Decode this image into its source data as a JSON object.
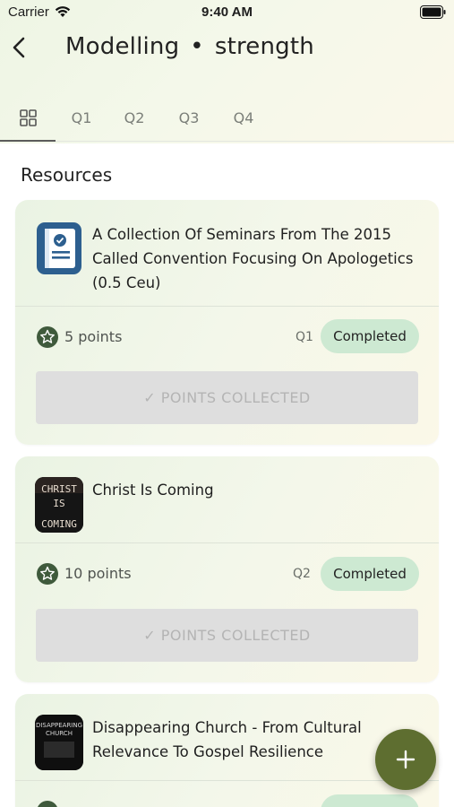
{
  "status_bar": {
    "carrier": "Carrier",
    "time": "9:40 AM"
  },
  "header": {
    "title_part1": "Modelling",
    "separator": "•",
    "title_part2": "strength"
  },
  "tabs": [
    {
      "label": "",
      "icon": "grid-icon",
      "active": true
    },
    {
      "label": "Q1"
    },
    {
      "label": "Q2"
    },
    {
      "label": "Q3"
    },
    {
      "label": "Q4"
    }
  ],
  "section_title": "Resources",
  "resources": [
    {
      "title": " A Collection Of Seminars From The 2015 Called Convention Focusing On Apologetics (0.5 Ceu)",
      "icon": "certificate-icon",
      "points": "5 points",
      "quarter": "Q1",
      "status": "Completed",
      "action": "✓ POINTS COLLECTED"
    },
    {
      "title": "Christ Is Coming",
      "icon": "book-cover",
      "cover_text": [
        "CHRIST",
        "IS",
        "COMING"
      ],
      "points": "10 points",
      "quarter": "Q2",
      "status": "Completed",
      "action": "✓ POINTS COLLECTED"
    },
    {
      "title": " Disappearing Church -  From Cultural Relevance To Gospel Resilience",
      "icon": "book-cover",
      "cover_text": [
        "DISAPPEARING",
        "CHURCH"
      ]
    }
  ],
  "fab_label": "+",
  "colors": {
    "accent": "#5e6e30",
    "badge": "#cde9d2",
    "star": "#3f5a3c",
    "doc_icon": "#2d5f8f"
  }
}
